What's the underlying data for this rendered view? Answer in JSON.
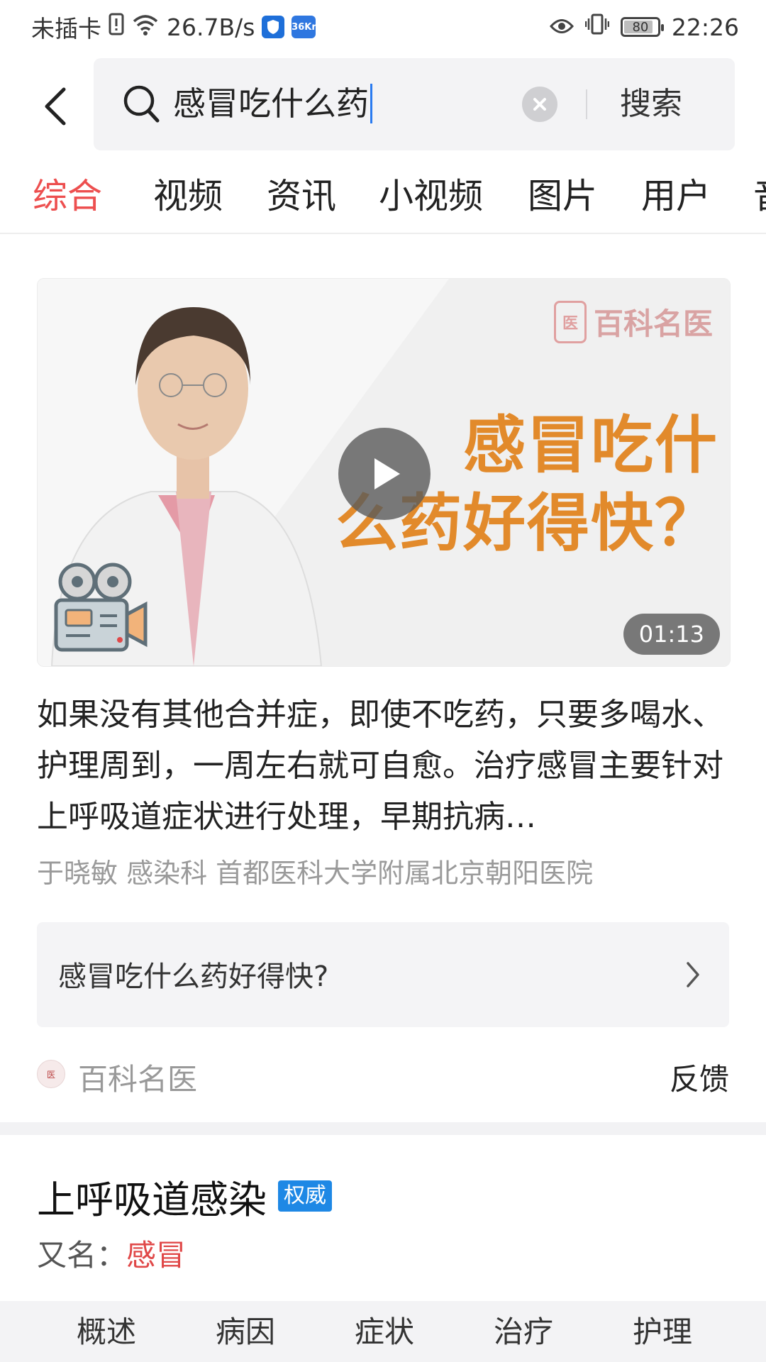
{
  "status_bar": {
    "carrier": "未插卡",
    "speed": "26.7B/s",
    "badge_app": "36Kr",
    "battery": "80",
    "time": "22:26"
  },
  "search": {
    "query": "感冒吃什么药",
    "button_label": "搜索"
  },
  "tabs": [
    "综合",
    "视频",
    "资讯",
    "小视频",
    "图片",
    "用户",
    "音"
  ],
  "active_tab_index": 0,
  "video": {
    "watermark_brand": "百科名医",
    "title_overlay_line1": "感冒吃什",
    "title_overlay_line2": "么药好得快？",
    "duration": "01:13"
  },
  "result": {
    "description": "如果没有其他合并症，即使不吃药，只要多喝水、护理周到，一周左右就可自愈。治疗感冒主要针对上呼吸道症状进行处理，早期抗病…",
    "author_meta": "于晓敏 感染科 首都医科大学附属北京朝阳医院",
    "related_question": "感冒吃什么药好得快?",
    "source": "百科名医",
    "feedback": "反馈"
  },
  "entry": {
    "title": "上呼吸道感染",
    "badge": "权威",
    "alias_label": "又名：",
    "alias_value": "感冒",
    "sub_tabs": [
      "概述",
      "病因",
      "症状",
      "治疗",
      "护理"
    ]
  },
  "colors": {
    "accent_red": "#ed4f4f",
    "badge_blue": "#1e88e5",
    "caret_blue": "#2a7bf0",
    "overlay_orange": "#e28a2b"
  }
}
